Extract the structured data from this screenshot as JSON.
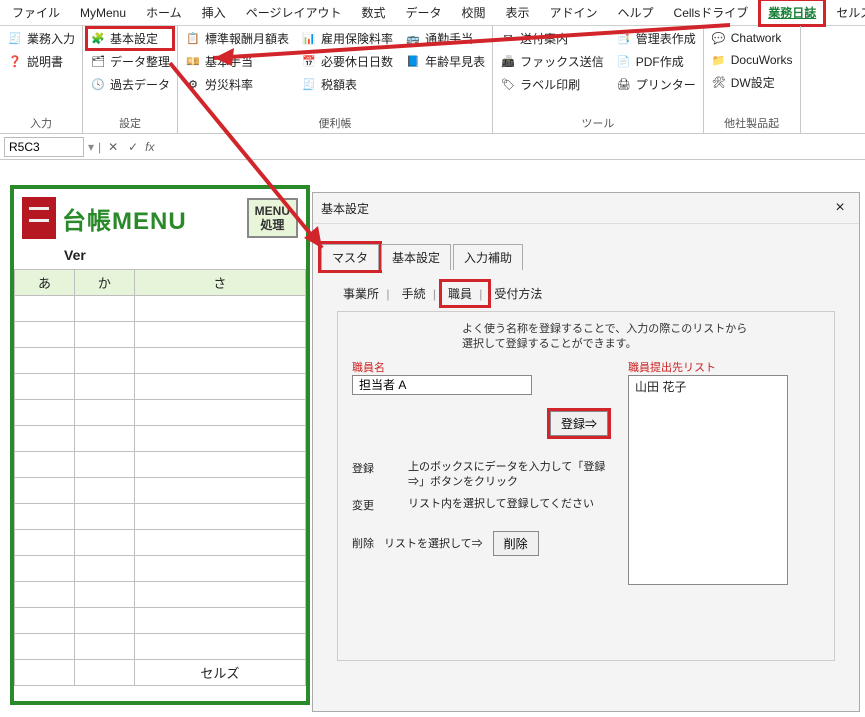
{
  "menubar": {
    "items": [
      "ファイル",
      "MyMenu",
      "ホーム",
      "挿入",
      "ページレイアウト",
      "数式",
      "データ",
      "校閲",
      "表示",
      "アドイン",
      "ヘルプ",
      "Cellsドライブ",
      "業務日誌",
      "セルズサポー"
    ]
  },
  "ribbon": {
    "groups": [
      {
        "label": "入力",
        "items": [
          {
            "icon": "🧾",
            "text": "業務入力"
          },
          {
            "icon": "❓",
            "text": "説明書"
          }
        ]
      },
      {
        "label": "設定",
        "items": [
          {
            "icon": "🧩",
            "text": "基本設定"
          },
          {
            "icon": "🗂",
            "text": "データ整理"
          },
          {
            "icon": "🕓",
            "text": "過去データ"
          }
        ]
      },
      {
        "label": "便利帳",
        "items": [
          {
            "icon": "📋",
            "text": "標準報酬月額表"
          },
          {
            "icon": "💴",
            "text": "基本手当"
          },
          {
            "icon": "⚙",
            "text": "労災料率"
          },
          {
            "icon": "📊",
            "text": "雇用保険料率"
          },
          {
            "icon": "📅",
            "text": "必要休日日数"
          },
          {
            "icon": "🧾",
            "text": "税額表"
          },
          {
            "icon": "🚌",
            "text": "通勤手当"
          },
          {
            "icon": "📘",
            "text": "年齢早見表"
          }
        ]
      },
      {
        "label": "ツール",
        "items": [
          {
            "icon": "✉",
            "text": "送付案内"
          },
          {
            "icon": "📠",
            "text": "ファックス送信"
          },
          {
            "icon": "🏷",
            "text": "ラベル印刷"
          },
          {
            "icon": "📑",
            "text": "管理表作成"
          },
          {
            "icon": "📄",
            "text": "PDF作成"
          },
          {
            "icon": "🖨",
            "text": "プリンター"
          }
        ]
      },
      {
        "label": "他社製品起",
        "items": [
          {
            "icon": "💬",
            "text": "Chatwork"
          },
          {
            "icon": "📁",
            "text": "DocuWorks"
          },
          {
            "icon": "🛠",
            "text": "DW設定"
          }
        ]
      }
    ]
  },
  "fx": {
    "name": "R5C3",
    "fx": "fx"
  },
  "sheet": {
    "title": "台帳MENU",
    "menuBtn": "MENU\n処理",
    "ver": "Ver",
    "headers": [
      "あ",
      "か",
      "さ"
    ],
    "footer_cell": "セルズ"
  },
  "dialog": {
    "title": "基本設定",
    "close": "×",
    "tabs": [
      "マスタ",
      "基本設定",
      "入力補助"
    ],
    "subtabs": [
      "事業所",
      "手続",
      "職員",
      "受付方法"
    ],
    "hint": "よく使う名称を登録することで、入力の際このリストから\n選択して登録することができます。",
    "staff_label": "職員名",
    "staff_value": "担当者 A",
    "list_label": "職員提出先リスト",
    "list_item0": "山田 花子",
    "register": "登録⇒",
    "kv": [
      {
        "k": "登録",
        "v": "上のボックスにデータを入力して「登録⇒」ボタンをクリック"
      },
      {
        "k": "変更",
        "v": "リスト内を選択して登録してください"
      },
      {
        "k": "削除",
        "v": "リストを選択して⇒"
      }
    ],
    "delete_btn": "削除"
  }
}
